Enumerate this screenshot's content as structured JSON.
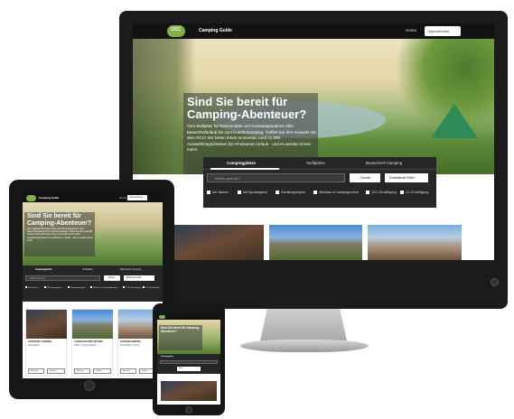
{
  "colors": {
    "brand_green": "#7cb342",
    "nav_dark": "#121212",
    "search_panel": "#262626"
  },
  "site": {
    "logo_text": "OCC",
    "brand": "Camping Guide",
    "nav_home": "Home",
    "login": "Unternehmen"
  },
  "hero": {
    "title": "Sind Sie bereit für Camping-Abenteuer?",
    "lead": "Vom Stellplatz für Reisemobile und Caravangespanne über Bauernhofurlaub bis zum Komfortcamping. Treffen Sie Ihre Auswahl mit dem OCC! Wir bieten Ihnen momentan rund 21.000 Auswahlmöglichkeiten für erholsamen Urlaub - und es werden immer mehr!"
  },
  "search": {
    "tabs": [
      "Campingplätze",
      "Stellplätze",
      "Bauernhof-Camping"
    ],
    "placeholder": "Wohin geht es?",
    "search_button": "Suche",
    "filter_button": "Erweiterte Filter",
    "filters": [
      "Am Wasser",
      "Mit Sportangebot",
      "Familiengeeignet",
      "Wellness & Campingkomfort",
      "OCC-Ermäßigung",
      "CC-Ermäßigung"
    ]
  },
  "tablet_cards": [
    {
      "title": "OUTDOOR CAMPING",
      "location": "Deutschland",
      "btn1": "Anfrage",
      "btn2": "Details"
    },
    {
      "title": "CARAVAN PARK SEXTEN",
      "location": "Italien, Trentino-Südtirol",
      "btn1": "Anfrage",
      "btn2": "Details"
    },
    {
      "title": "OSTSEECAMPING",
      "location": "Deutschland, Ostsee",
      "btn1": "Anfrage",
      "btn2": "Details"
    }
  ],
  "phone": {
    "filter_button": "Filter"
  }
}
